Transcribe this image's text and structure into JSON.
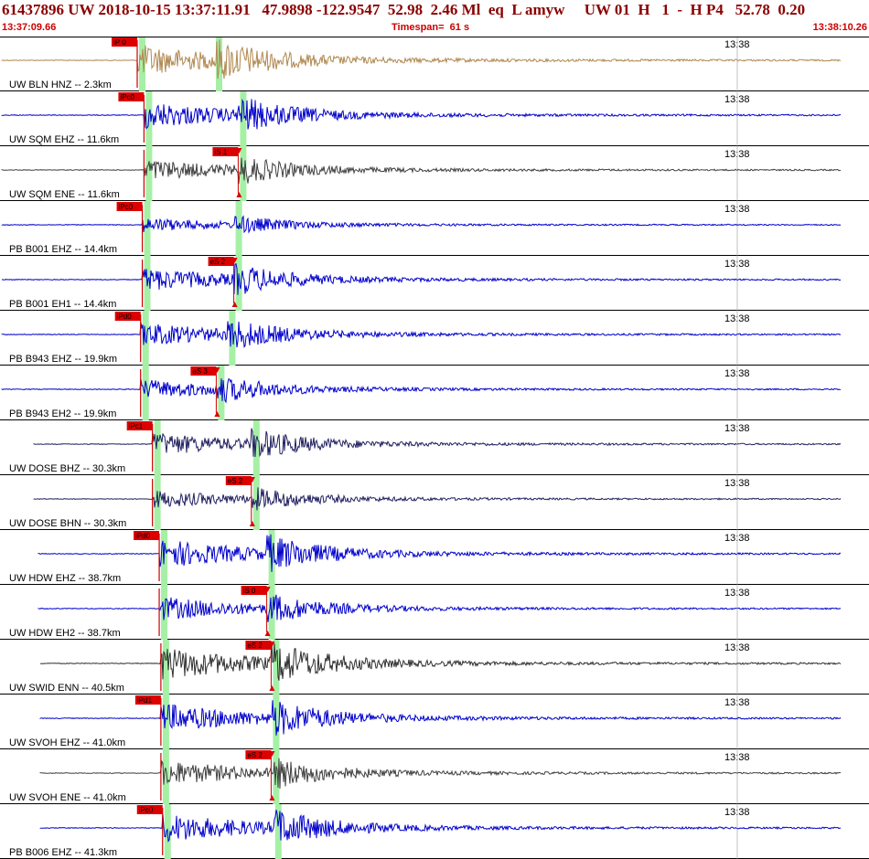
{
  "header": {
    "title": "61437896 UW 2018-10-15 13:37:11.91   47.9898 -122.9547  52.98  2.46 Ml  eq  L amyw     UW 01  H   1  -  H P4   52.78  0.20",
    "start_time": "13:37:09.66",
    "timespan_label": "Timespan=  61 s",
    "end_time": "13:38:10.26"
  },
  "chart_data": {
    "type": "line",
    "tick_label": "13:38",
    "series": [
      {
        "label": "UW BLN HNZ -- 2.3km",
        "color": "#b08850",
        "tag": "iP 0",
        "p_time": 0.0,
        "s_time": 3.5,
        "amp": 0.8,
        "start": 0.0
      },
      {
        "label": "UW SQM EHZ -- 11.6km",
        "color": "#0000cc",
        "tag": "iPc0",
        "p_time": 0.4,
        "s_time": 4.6,
        "amp": 0.7,
        "start": 0.0
      },
      {
        "label": "UW SQM ENE -- 11.6km",
        "color": "#404040",
        "tag": "iS 1",
        "p_time": 0.4,
        "s_time": 4.6,
        "amp": 0.55,
        "start": 0.0
      },
      {
        "label": "PB B001 EHZ -- 14.4km",
        "color": "#0000cc",
        "tag": "iPc0",
        "p_time": 0.3,
        "s_time": 4.4,
        "amp": 0.35,
        "start": 0.0
      },
      {
        "label": "PB B001 EH1 -- 14.4km",
        "color": "#0000cc",
        "tag": "eS 2",
        "p_time": 0.3,
        "s_time": 4.4,
        "amp": 0.6,
        "start": 0.0
      },
      {
        "label": "PB B943 EHZ -- 19.9km",
        "color": "#0000cc",
        "tag": "iPd0",
        "p_time": 0.2,
        "s_time": 4.1,
        "amp": 0.6,
        "start": 0.0
      },
      {
        "label": "PB B943 EH2 -- 19.9km",
        "color": "#0000cc",
        "tag": "eS 3",
        "p_time": 0.2,
        "s_time": 3.6,
        "amp": 0.5,
        "start": 0.0
      },
      {
        "label": "UW DOSE BHZ -- 30.3km",
        "color": "#202060",
        "tag": "iPc1",
        "p_time": 0.9,
        "s_time": 5.2,
        "amp": 0.6,
        "start": 0.7
      },
      {
        "label": "UW DOSE BHN -- 30.3km",
        "color": "#202060",
        "tag": "eS 2",
        "p_time": 0.9,
        "s_time": 5.2,
        "amp": 0.45,
        "start": 0.7
      },
      {
        "label": "UW HDW EHZ -- 38.7km",
        "color": "#0000cc",
        "tag": "iPd0",
        "p_time": 1.3,
        "s_time": 5.9,
        "amp": 0.75,
        "start": 1.2
      },
      {
        "label": "UW HDW EH2 -- 38.7km",
        "color": "#0000cc",
        "tag": "iS 0",
        "p_time": 1.3,
        "s_time": 5.9,
        "amp": 0.6,
        "start": 1.2
      },
      {
        "label": "UW SWID ENN -- 40.5km",
        "color": "#303030",
        "tag": "eS 2",
        "p_time": 1.4,
        "s_time": 6.1,
        "amp": 0.85,
        "start": 1.4
      },
      {
        "label": "UW SVOH EHZ -- 41.0km",
        "color": "#0000cc",
        "tag": "iPd1",
        "p_time": 1.4,
        "s_time": 6.1,
        "amp": 0.75,
        "start": 1.4
      },
      {
        "label": "UW SVOH ENE -- 41.0km",
        "color": "#404040",
        "tag": "eS 2",
        "p_time": 1.4,
        "s_time": 6.1,
        "amp": 0.65,
        "start": 1.4
      },
      {
        "label": "PB B006 EHZ -- 41.3km",
        "color": "#0000cc",
        "tag": "iPc0",
        "p_time": 1.5,
        "s_time": 6.2,
        "amp": 0.75,
        "start": 1.4
      }
    ]
  }
}
